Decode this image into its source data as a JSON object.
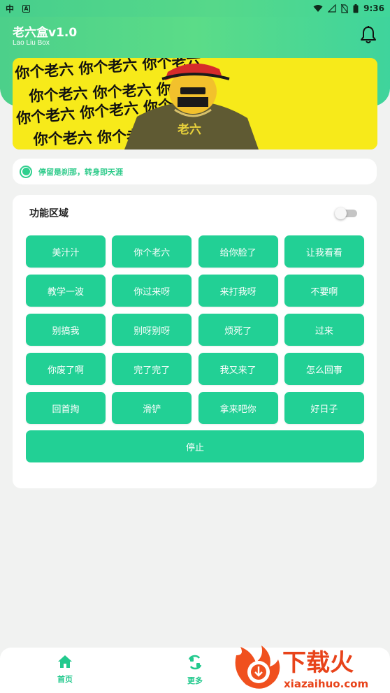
{
  "status_bar": {
    "left_icon_1": "bug-icon",
    "left_icon_2": "A",
    "time": "9:36",
    "icons": [
      "wifi-icon",
      "signal-icon",
      "no-sim-icon",
      "battery-icon"
    ]
  },
  "header": {
    "title": "老六盒v1.0",
    "subtitle": "Lao Liu Box",
    "bell_icon": "bell-icon"
  },
  "banner": {
    "text_rows": [
      "你个老六   你个老六   你个老六",
      "你个老六   你个老六   你个老六",
      "你个老六   你个老六   你个老六",
      "你个老六   你个老六   你个老六"
    ],
    "shirt_text": "老六"
  },
  "quote": {
    "text": "停留是刹那，转身即天涯"
  },
  "function_area": {
    "title": "功能区域",
    "toggle_on": false,
    "buttons": [
      "美汁汁",
      "你个老六",
      "给你脸了",
      "让我看看",
      "教学一波",
      "你过来呀",
      "来打我呀",
      "不要啊",
      "别搞我",
      "别呀别呀",
      "烦死了",
      "过来",
      "你废了啊",
      "完了完了",
      "我又来了",
      "怎么回事",
      "回首掏",
      "滑铲",
      "拿来吧你",
      "好日子"
    ],
    "stop_label": "停止"
  },
  "bottom_nav": {
    "items": [
      {
        "label": "首页",
        "icon": "home-icon"
      },
      {
        "label": "更多",
        "icon": "more-icon"
      }
    ]
  },
  "watermark": {
    "brand": "下载火",
    "domain": "xiazaihuo.com"
  },
  "colors": {
    "accent": "#22d095",
    "header_green": "#4cd08a",
    "banner_yellow": "#f7ea1a"
  }
}
